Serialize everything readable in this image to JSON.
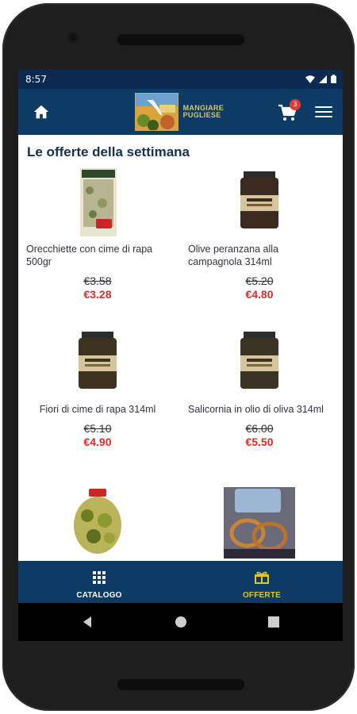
{
  "status": {
    "time": "8:57"
  },
  "brand": {
    "line1": "MANGIARE",
    "line2": "PUGLIESE"
  },
  "cart": {
    "count": "3"
  },
  "section_title": "Le offerte della settimana",
  "products": [
    {
      "name": "Orecchiette con cime di rapa 500gr",
      "old_price": "€3.58",
      "new_price": "€3.28"
    },
    {
      "name": "Olive peranzana alla campagnola 314ml",
      "old_price": "€5.20",
      "new_price": "€4.80"
    },
    {
      "name": "Fiori di cime di rapa 314ml",
      "old_price": "€5.10",
      "new_price": "€4.90"
    },
    {
      "name": "Salicornia in olio di oliva 314ml",
      "old_price": "€6.00",
      "new_price": "€5.50"
    }
  ],
  "bottom_nav": {
    "catalog": "CATALOGO",
    "offers": "OFFERTE"
  },
  "colors": {
    "primary": "#0d3b66",
    "statusbar": "#0c2a4f",
    "accent": "#e5c42a",
    "sale": "#e02b2b"
  },
  "icons": [
    "home-icon",
    "cart-icon",
    "menu-icon",
    "grid-icon",
    "gift-icon",
    "back-icon",
    "home-circle-icon",
    "recents-icon"
  ]
}
